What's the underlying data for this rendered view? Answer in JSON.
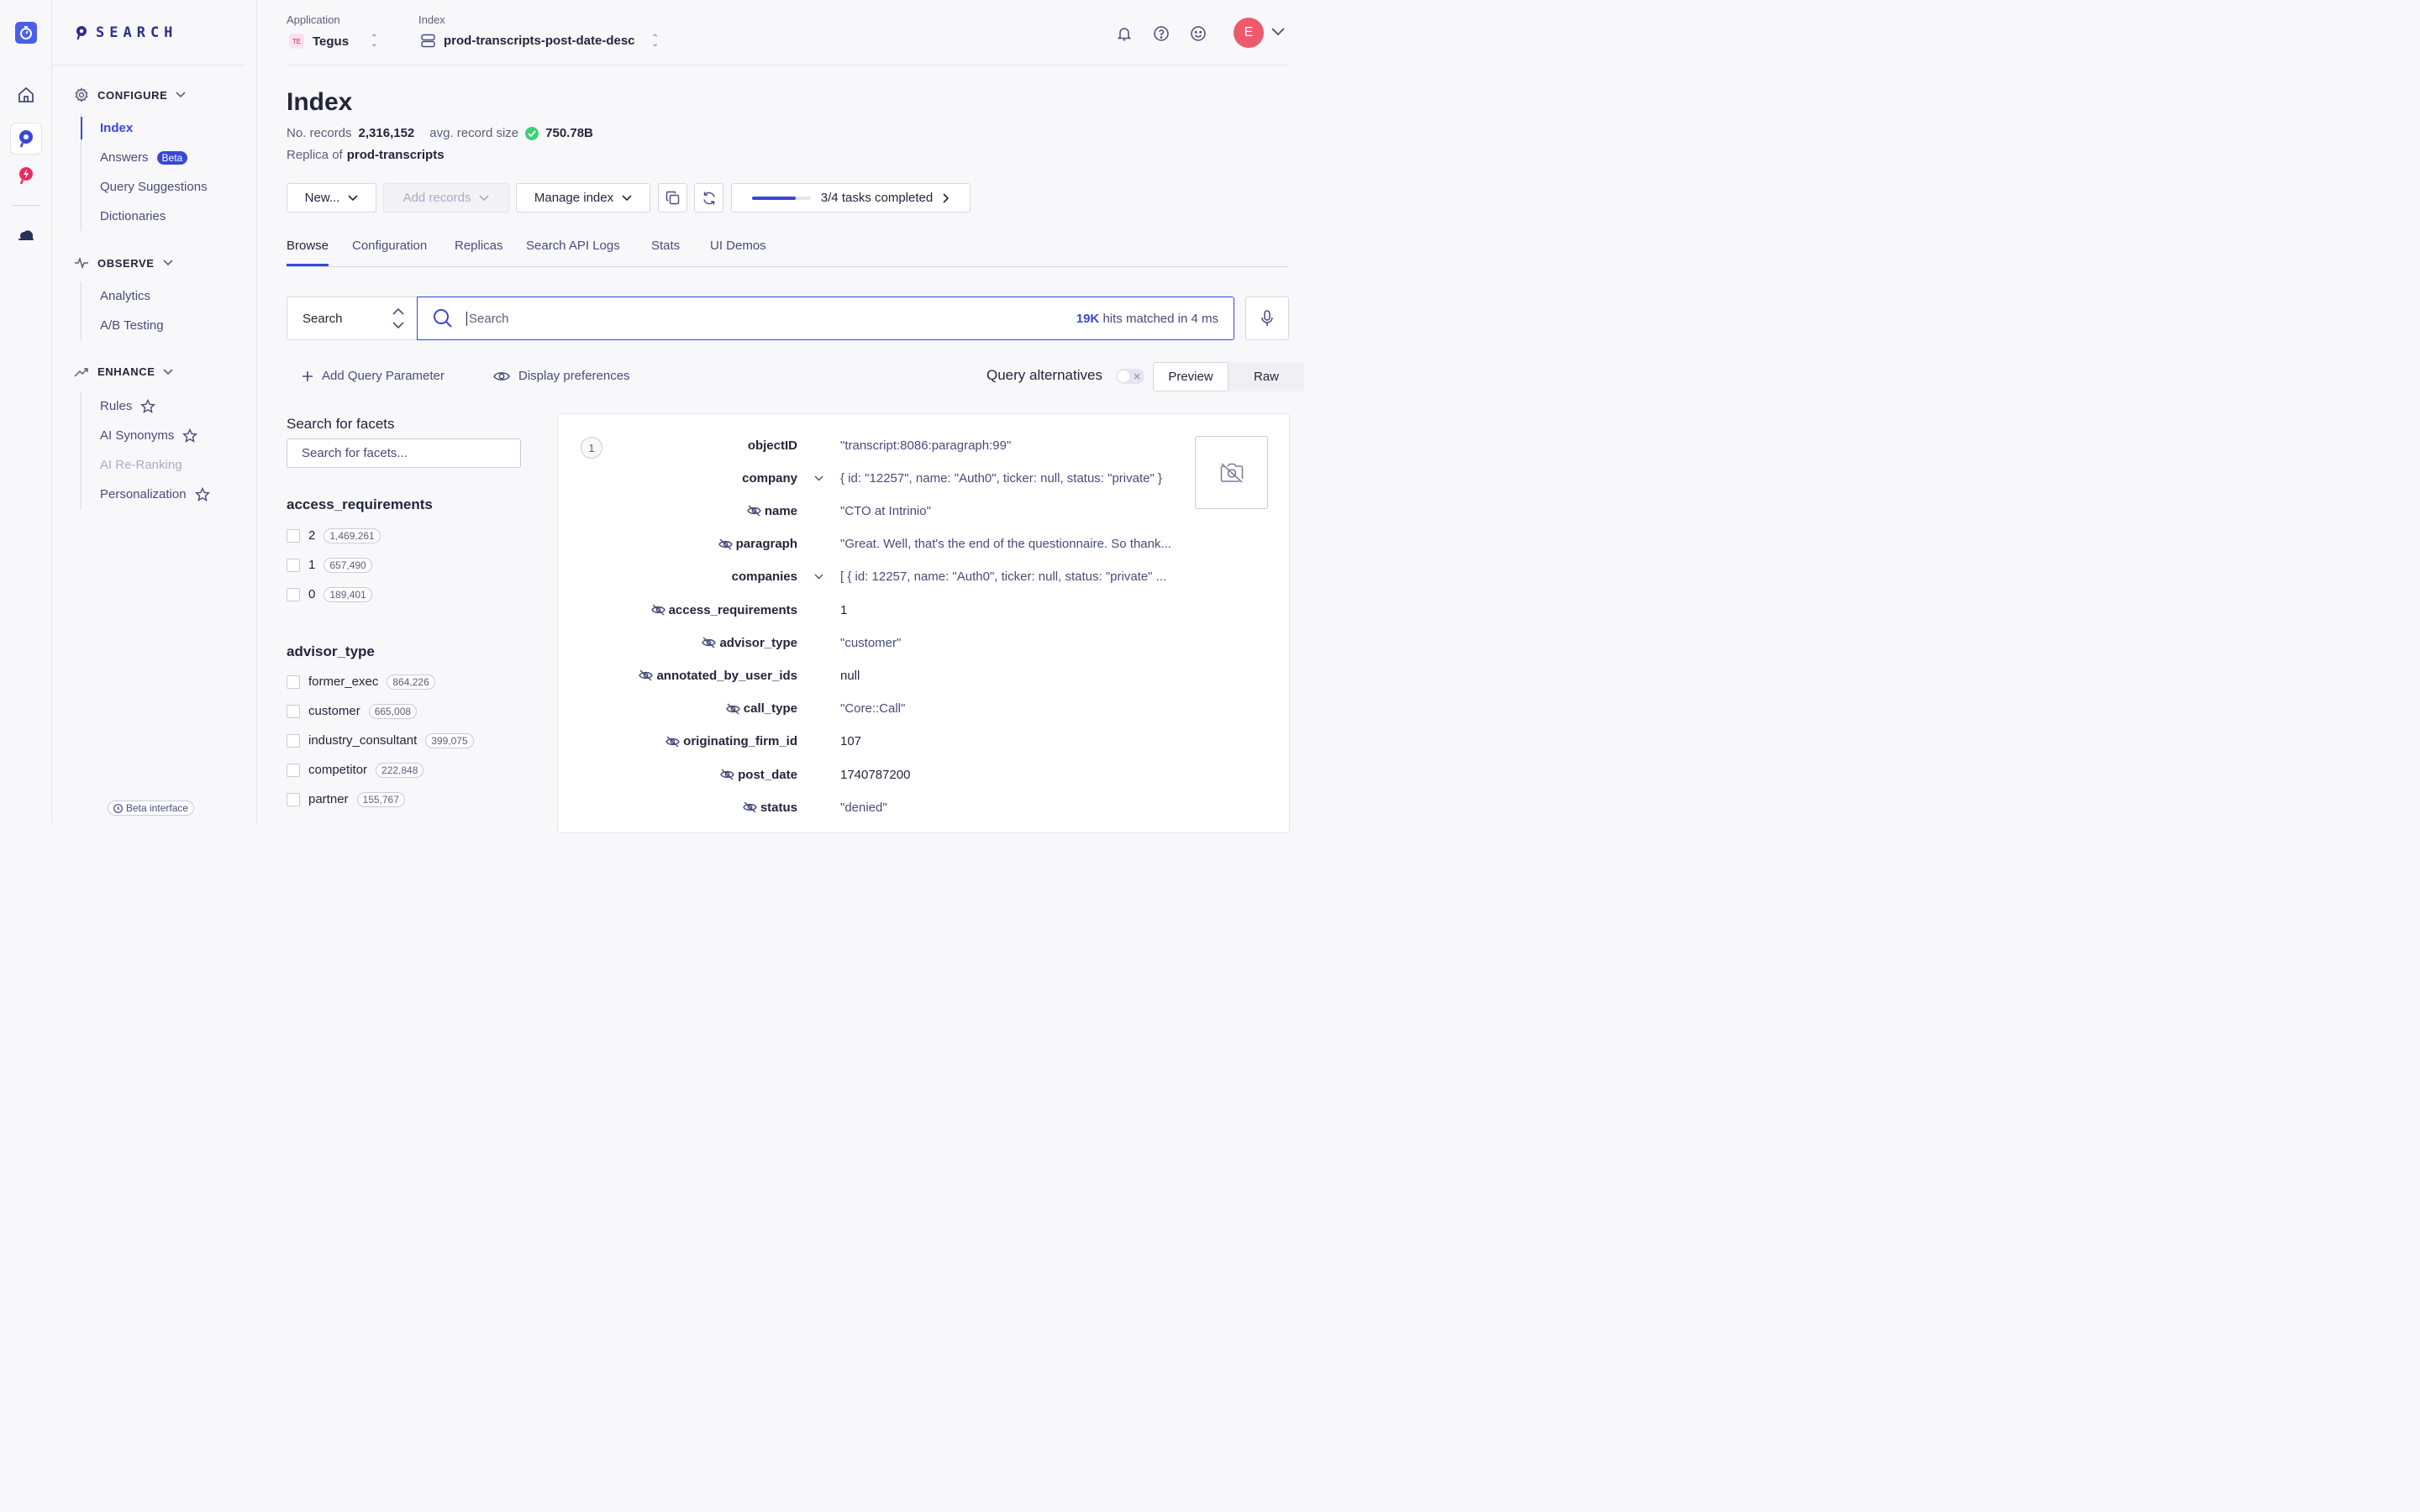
{
  "sidebar": {
    "logo": "SEARCH",
    "sections": [
      {
        "title": "CONFIGURE",
        "items": [
          {
            "label": "Index",
            "active": true
          },
          {
            "label": "Answers",
            "badge": "Beta"
          },
          {
            "label": "Query Suggestions"
          },
          {
            "label": "Dictionaries"
          }
        ]
      },
      {
        "title": "OBSERVE",
        "items": [
          {
            "label": "Analytics"
          },
          {
            "label": "A/B Testing"
          }
        ]
      },
      {
        "title": "ENHANCE",
        "items": [
          {
            "label": "Rules",
            "star": true
          },
          {
            "label": "AI Synonyms",
            "star": true
          },
          {
            "label": "AI Re-Ranking",
            "disabled": true
          },
          {
            "label": "Personalization",
            "star": true
          }
        ]
      }
    ],
    "beta_interface": "Beta interface"
  },
  "header": {
    "application_label": "Application",
    "application_badge": "TE",
    "application_value": "Tegus",
    "index_label": "Index",
    "index_value": "prod-transcripts-post-date-desc",
    "avatar_initial": "E"
  },
  "page": {
    "title": "Index",
    "records_label": "No. records",
    "records_value": "2,316,152",
    "avg_size_label": "avg. record size",
    "avg_size_value": "750.78B",
    "replica_label": "Replica of",
    "replica_value": "prod-transcripts"
  },
  "toolbar": {
    "new_label": "New...",
    "add_records_label": "Add records",
    "manage_index_label": "Manage index",
    "tasks_label": "3/4 tasks completed",
    "tasks_progress": 0.75
  },
  "tabs": [
    "Browse",
    "Configuration",
    "Replicas",
    "Search API Logs",
    "Stats",
    "UI Demos"
  ],
  "search": {
    "type_label": "Search",
    "placeholder": "Search",
    "hits_count": "19K",
    "hits_text": "hits matched in 4 ms"
  },
  "subtoolbar": {
    "add_query_param": "Add Query Parameter",
    "display_prefs": "Display preferences",
    "query_alternatives": "Query alternatives",
    "preview": "Preview",
    "raw": "Raw"
  },
  "facets": {
    "title": "Search for facets",
    "placeholder": "Search for facets...",
    "groups": [
      {
        "name": "access_requirements",
        "values": [
          {
            "label": "2",
            "count": "1,469,261"
          },
          {
            "label": "1",
            "count": "657,490"
          },
          {
            "label": "0",
            "count": "189,401"
          }
        ]
      },
      {
        "name": "advisor_type",
        "values": [
          {
            "label": "former_exec",
            "count": "864,226"
          },
          {
            "label": "customer",
            "count": "665,008"
          },
          {
            "label": "industry_consultant",
            "count": "399,075"
          },
          {
            "label": "competitor",
            "count": "222,848"
          },
          {
            "label": "partner",
            "count": "155,767"
          }
        ]
      }
    ]
  },
  "record": {
    "number": "1",
    "fields": [
      {
        "key": "objectID",
        "value": "\"transcript:8086:paragraph:99\"",
        "hidden": false,
        "expandable": false
      },
      {
        "key": "company",
        "value": "{ id: \"12257\", name: \"Auth0\", ticker: null, status: \"private\" }",
        "hidden": false,
        "expandable": true
      },
      {
        "key": "name",
        "value": "\"CTO at Intrinio\"",
        "hidden": true,
        "expandable": false
      },
      {
        "key": "paragraph",
        "value": "\"Great. Well, that's the end of the questionnaire. So thank...",
        "hidden": true,
        "expandable": false
      },
      {
        "key": "companies",
        "value": "[ { id: 12257, name: \"Auth0\", ticker: null, status: \"private\" ...",
        "hidden": false,
        "expandable": true
      },
      {
        "key": "access_requirements",
        "value": "1",
        "hidden": true,
        "expandable": false
      },
      {
        "key": "advisor_type",
        "value": "\"customer\"",
        "hidden": true,
        "expandable": false
      },
      {
        "key": "annotated_by_user_ids",
        "value": "null",
        "hidden": true,
        "expandable": false
      },
      {
        "key": "call_type",
        "value": "\"Core::Call\"",
        "hidden": true,
        "expandable": false
      },
      {
        "key": "originating_firm_id",
        "value": "107",
        "hidden": true,
        "expandable": false
      },
      {
        "key": "post_date",
        "value": "1740787200",
        "hidden": true,
        "expandable": false
      },
      {
        "key": "status",
        "value": "\"denied\"",
        "hidden": true,
        "expandable": false
      }
    ]
  },
  "colors": {
    "accent": "#3a46d6",
    "success": "#3fcf7a",
    "avatar": "#ec5a6c"
  }
}
